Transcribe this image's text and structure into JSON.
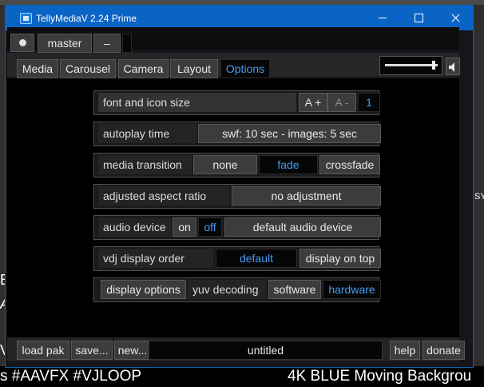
{
  "window": {
    "title": "TellyMediaV 2.24 Prime"
  },
  "master": {
    "label": "master",
    "minus_label": "–"
  },
  "tabs": [
    {
      "label": "Media"
    },
    {
      "label": "Carousel"
    },
    {
      "label": "Camera"
    },
    {
      "label": "Layout"
    },
    {
      "label": "Options",
      "active": true
    }
  ],
  "volume": {
    "level": 0.95
  },
  "options": {
    "font_size": {
      "label": "font and icon size",
      "increase": "A +",
      "decrease": "A -",
      "value": "1"
    },
    "autoplay": {
      "label": "autoplay time",
      "value": "swf: 10 sec - images: 5 sec"
    },
    "transition": {
      "label": "media transition",
      "choices": [
        "none",
        "fade",
        "crossfade"
      ],
      "selected": "fade"
    },
    "aspect": {
      "label": "adjusted aspect ratio",
      "value": "no adjustment"
    },
    "audio": {
      "label": "audio device",
      "on": "on",
      "off": "off",
      "selected": "off",
      "device": "default audio device"
    },
    "vdj": {
      "label": "vdj display order",
      "value": "default",
      "alt": "display on top"
    },
    "display": {
      "options_label": "display options",
      "decoding_label": "yuv decoding",
      "software": "software",
      "hardware": "hardware",
      "selected": "hardware"
    }
  },
  "bottom": {
    "load": "load pak",
    "save": "save...",
    "new": "new...",
    "filename": "untitled",
    "help": "help",
    "donate": "donate"
  },
  "background": {
    "left_text": "s #AAVFX #VJLOOP",
    "right_text": "4K BLUE Moving Backgrou",
    "edge_glyphs": [
      "E",
      "A",
      "V",
      "SY"
    ]
  },
  "colors": {
    "titlebar": "#0a64c5",
    "accent": "#4a9af0",
    "panel": "#000000"
  }
}
